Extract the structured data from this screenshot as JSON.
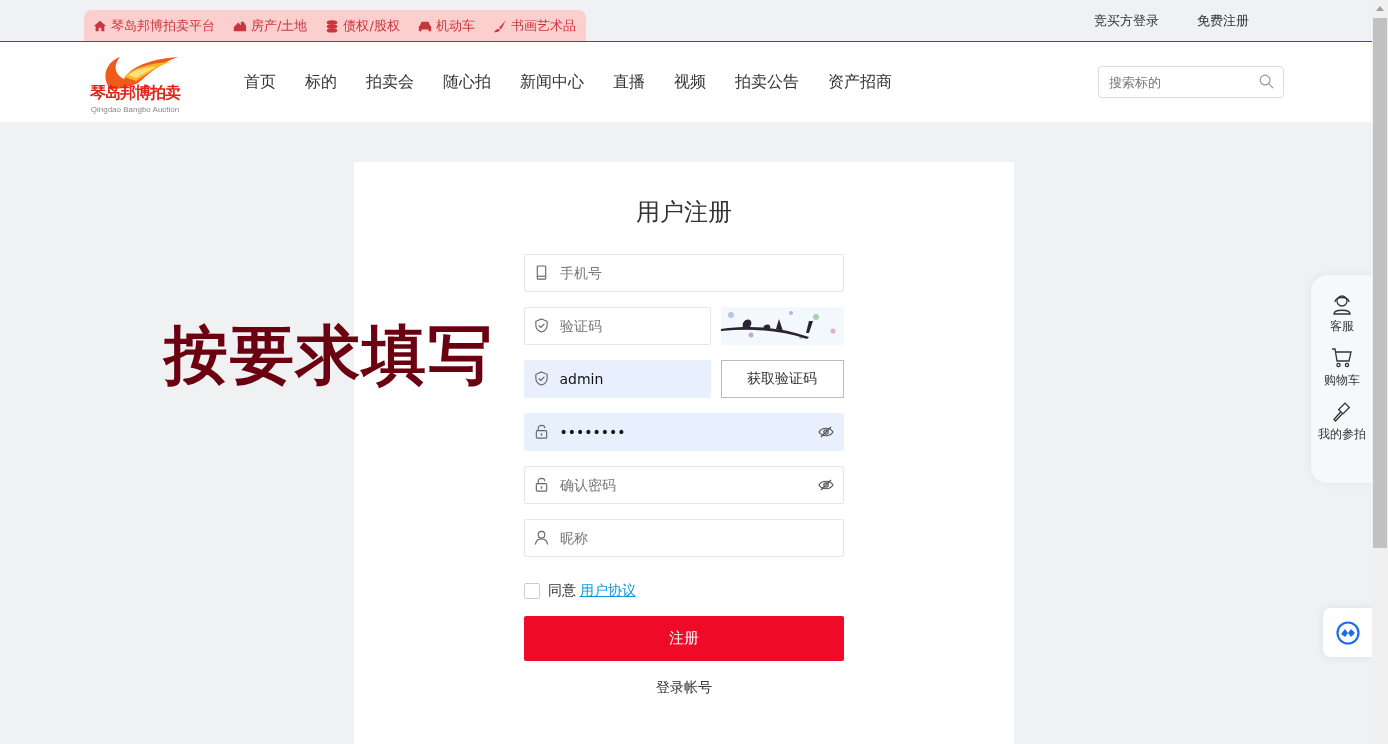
{
  "top_bar": {
    "categories": [
      {
        "label": "琴岛邦博拍卖平台",
        "kind": "home"
      },
      {
        "label": "房产/土地",
        "kind": "house"
      },
      {
        "label": "债权/股权",
        "kind": "coins"
      },
      {
        "label": "机动车",
        "kind": "car"
      },
      {
        "label": "书画艺术品",
        "kind": "brush"
      }
    ],
    "links": [
      "竞买方登录",
      "免费注册"
    ]
  },
  "header": {
    "logo": {
      "name": "琴岛邦博拍卖",
      "subtitle": "Qingdao Bangbo Auction"
    },
    "nav": [
      "首页",
      "标的",
      "拍卖会",
      "随心拍",
      "新闻中心",
      "直播",
      "视频",
      "拍卖公告",
      "资产招商"
    ],
    "search": {
      "placeholder": "搜索标的"
    }
  },
  "form": {
    "title": "用户注册",
    "fields": [
      {
        "kind": "phone",
        "placeholder": "手机号",
        "autofilled": false,
        "reveal_toggle": false
      },
      {
        "kind": "shield",
        "placeholder": "验证码",
        "autofilled": false,
        "reveal_toggle": false
      },
      {
        "kind": "shield",
        "value": "admin",
        "autofilled": true,
        "reveal_toggle": false,
        "addon": {
          "kind": "button",
          "label": "获取验证码"
        }
      },
      {
        "kind": "lock",
        "value": "••••••••",
        "autofilled": true,
        "reveal_toggle": true
      },
      {
        "kind": "lock",
        "placeholder": "确认密码",
        "autofilled": false,
        "reveal_toggle": true
      },
      {
        "kind": "user",
        "placeholder": "昵称",
        "autofilled": false,
        "reveal_toggle": false
      }
    ],
    "agreement": {
      "checked": false,
      "text": "同意",
      "link": "用户协议"
    },
    "submit": "注册",
    "login_link": "登录帐号"
  },
  "float_menu": [
    {
      "label": "客服",
      "kind": "service"
    },
    {
      "label": "购物车",
      "kind": "cart"
    },
    {
      "label": "我的参拍",
      "kind": "gavel"
    }
  ],
  "annotation": "按要求填写"
}
